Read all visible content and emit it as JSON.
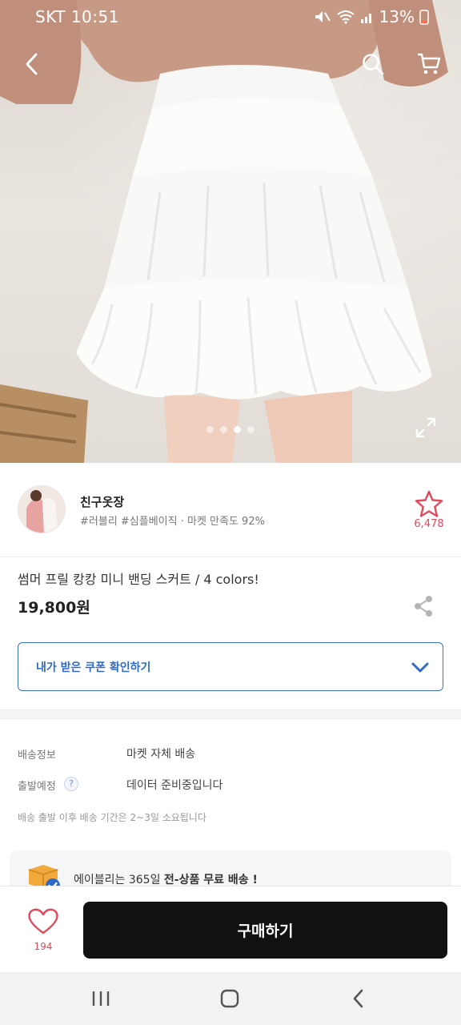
{
  "status_bar": {
    "carrier_time": "SKT 10:51",
    "battery": "13%"
  },
  "hero": {
    "slides_total": 4,
    "slide_active": 3,
    "icons": [
      "back-icon",
      "search-icon",
      "cart-icon",
      "expand-icon"
    ]
  },
  "shop": {
    "name": "친구옷장",
    "tags": "#러블리 #심플베이직 · 마켓 만족도 92%",
    "favorite_count": "6,478"
  },
  "product": {
    "title": "썸머 프릴 캉캉 미니 밴딩 스커트 / 4 colors!",
    "price": "19,800원"
  },
  "coupon": {
    "label": "내가 받은 쿠폰 확인하기"
  },
  "delivery": {
    "info_label": "배송정보",
    "info_value": "마켓 자체 배송",
    "departure_label": "출발예정",
    "departure_value": "데이터 준비중입니다",
    "help": "?",
    "note": "배송 출발 이후 배송 기간은 2~3일 소요됩니다"
  },
  "promo": {
    "text_prefix": "에이블리는 365일 ",
    "text_bold": "전-상품 무료 배송 !"
  },
  "buy_bar": {
    "like_count": "194",
    "buy_label": "구매하기"
  },
  "colors": {
    "accent_blue": "#2f6bc6",
    "like_red": "#e04a5c",
    "buy_button": "#111111"
  }
}
